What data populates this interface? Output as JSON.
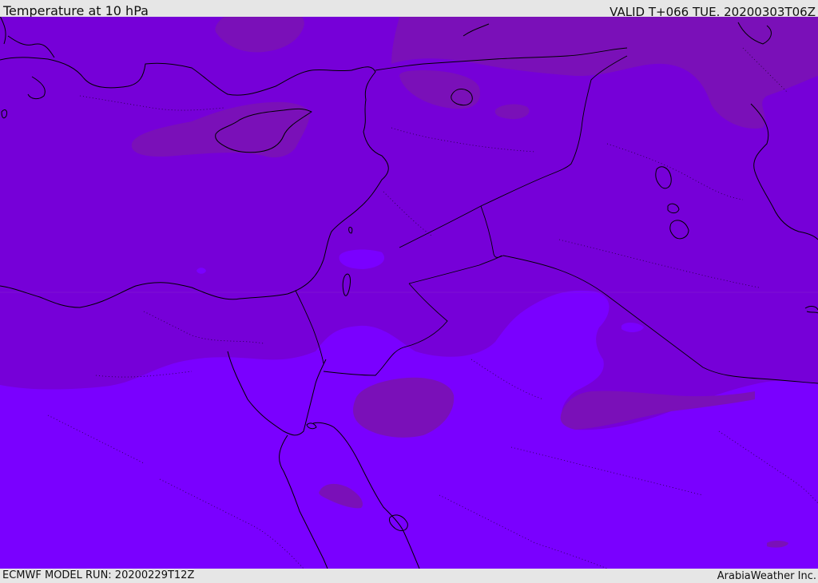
{
  "header": {
    "title": "Temperature at 10 hPa",
    "valid_time": "VALID T+066 TUE. 20200303T06Z"
  },
  "footer": {
    "model_run": "ECMWF MODEL RUN: 20200229T12Z",
    "credit": "ArabiaWeather Inc."
  },
  "colors": {
    "band_warm": "#7a10b8",
    "band_mid": "#7600d8",
    "band_cool": "#7a00ff",
    "coastline": "#000000",
    "background": "#e6e6e6"
  }
}
